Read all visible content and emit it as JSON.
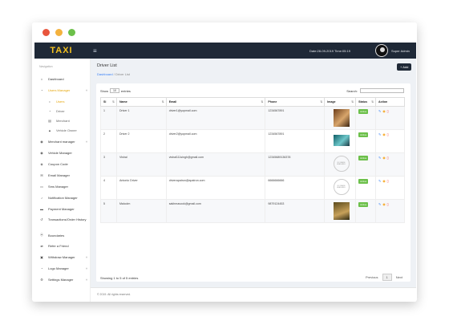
{
  "window": {
    "controls": [
      "close",
      "minimize",
      "maximize"
    ]
  },
  "topbar": {
    "brand": "TAXI",
    "menu_icon": "hamburger-icon",
    "datetime": "Date:28-09-2019 Time:05:19",
    "user": "Super Admin"
  },
  "sidebar": {
    "heading": "Navigation",
    "items": [
      {
        "label": "Dashboard",
        "icon": "home-icon"
      },
      {
        "label": "Users Manager",
        "icon": "user-icon"
      },
      {
        "label": "Users",
        "icon": "user-icon"
      },
      {
        "label": "Driver",
        "icon": "user-icon"
      },
      {
        "label": "Merchant",
        "icon": "id-card-icon"
      },
      {
        "label": "Vehicle Owner",
        "icon": "warning-icon"
      },
      {
        "label": "Merchant manager",
        "icon": "car-icon"
      },
      {
        "label": "Vehicle Manager",
        "icon": "car-icon"
      },
      {
        "label": "Coupon Code",
        "icon": "ticket-icon"
      },
      {
        "label": "Email Manager",
        "icon": "envelope-icon"
      },
      {
        "label": "Sms Manager",
        "icon": "sms-icon"
      },
      {
        "label": "Notification Manager",
        "icon": "bell-icon"
      },
      {
        "label": "Payment Manager",
        "icon": "credit-card-icon"
      },
      {
        "label": "Transactions/Order History",
        "icon": "history-icon"
      },
      {
        "label": "Boundaries",
        "icon": "map-marker-icon"
      },
      {
        "label": "Refer a Friend",
        "icon": "share-icon"
      },
      {
        "label": "Withdraw Manager",
        "icon": "wallet-icon"
      },
      {
        "label": "Logo Manager",
        "icon": "user-icon"
      },
      {
        "label": "Settings Manager",
        "icon": "gear-icon"
      }
    ]
  },
  "page": {
    "title": "Driver List",
    "breadcrumb_home": "Dashboard",
    "breadcrumb_sep": "/",
    "breadcrumb_current": "Driver List",
    "add_button": "+ Add"
  },
  "table_controls": {
    "show_label": "Show",
    "entries_value": "10",
    "entries_label": "entries",
    "search_label": "Search:",
    "search_value": ""
  },
  "table": {
    "columns": [
      "Sl",
      "Name",
      "Email",
      "Phone",
      "Image",
      "Status",
      "Action"
    ],
    "rows": [
      {
        "sl": "1",
        "name": "Driver 1",
        "email": "driver1@yopmail.com",
        "phone": "1234567891",
        "image": "photo",
        "status": "Active"
      },
      {
        "sl": "2",
        "name": "Driver 2",
        "email": "driver2@yopmail.com",
        "phone": "1234567891",
        "image": "photo",
        "status": "Active"
      },
      {
        "sl": "3",
        "name": "Vishal",
        "email": "vishal111singh@gmail.com",
        "phone": "12345689136378",
        "image": "NO IMAGE AVAILABLE",
        "status": "Active"
      },
      {
        "sl": "4",
        "name": "Antonio Driver",
        "email": "driverapatron@apatron.com",
        "phone": "6666666666",
        "image": "NO IMAGE AVAILABLE",
        "status": "Active"
      },
      {
        "sl": "5",
        "name": "Malcolm",
        "email": "sakhmasook@gmail.com",
        "phone": "9879124453",
        "image": "photo",
        "status": "Active"
      }
    ],
    "info": "Showing 1 to 5 of 5 entries",
    "pagination": {
      "previous": "Previous",
      "current": "1",
      "next": "Next"
    }
  },
  "footer": {
    "text": "© 2019. All rights reserved."
  }
}
